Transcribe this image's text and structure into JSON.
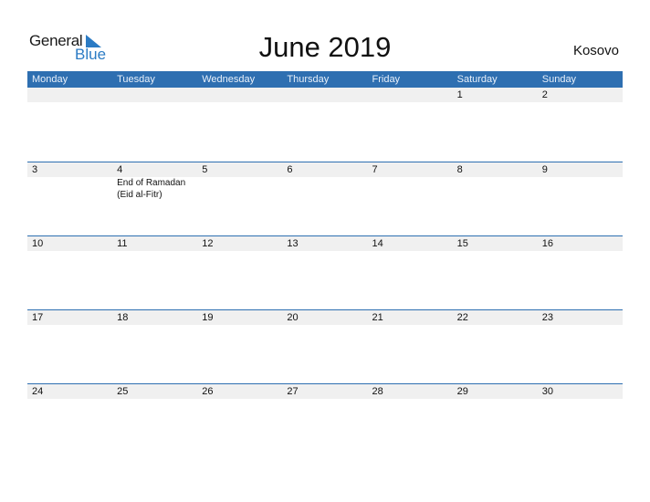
{
  "logo": {
    "general": "General",
    "blue": "Blue"
  },
  "title": "June 2019",
  "country": "Kosovo",
  "weekdays": [
    "Monday",
    "Tuesday",
    "Wednesday",
    "Thursday",
    "Friday",
    "Saturday",
    "Sunday"
  ],
  "weeks": [
    {
      "days": [
        "",
        "",
        "",
        "",
        "",
        "1",
        "2"
      ]
    },
    {
      "days": [
        "3",
        "4",
        "5",
        "6",
        "7",
        "8",
        "9"
      ]
    },
    {
      "days": [
        "10",
        "11",
        "12",
        "13",
        "14",
        "15",
        "16"
      ]
    },
    {
      "days": [
        "17",
        "18",
        "19",
        "20",
        "21",
        "22",
        "23"
      ]
    },
    {
      "days": [
        "24",
        "25",
        "26",
        "27",
        "28",
        "29",
        "30"
      ]
    }
  ],
  "holidays": [
    {
      "week": 1,
      "weekday": 1,
      "lines": [
        "End of Ramadan",
        "(Eid al-Fitr)"
      ]
    }
  ],
  "colors": {
    "header_bg": "#2e6fb1",
    "brand_blue": "#2b7bc4",
    "day_strip": "#f0f0f0"
  }
}
